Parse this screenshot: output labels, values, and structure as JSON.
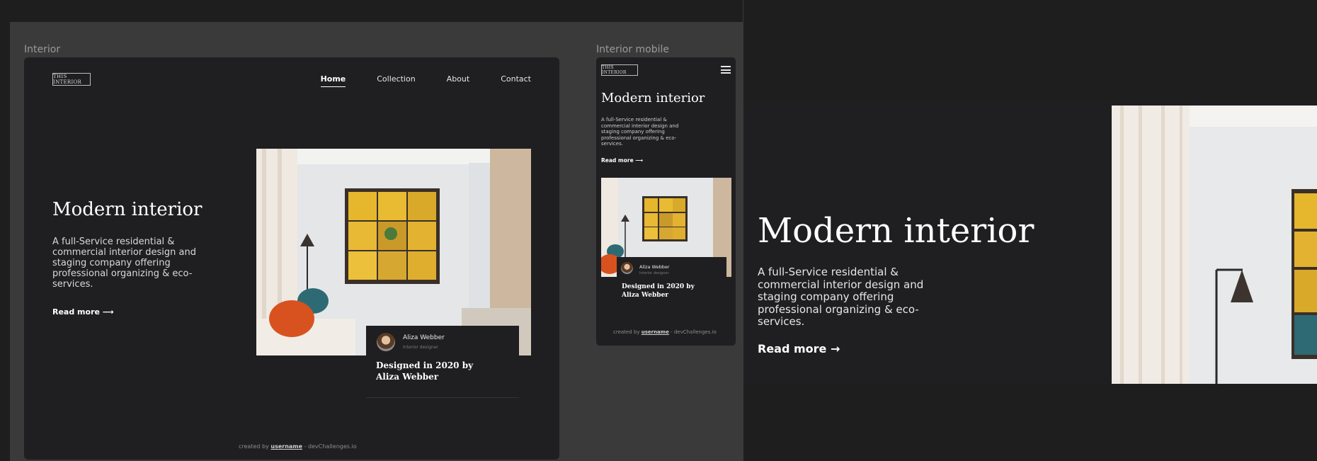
{
  "frames": {
    "desktop_label": "Interior",
    "mobile_label": "Interior mobile"
  },
  "site": {
    "logo": "THIS INTERIOR",
    "nav": [
      {
        "label": "Home",
        "active": true
      },
      {
        "label": "Collection",
        "active": false
      },
      {
        "label": "About",
        "active": false
      },
      {
        "label": "Contact",
        "active": false
      }
    ],
    "hero": {
      "title": "Modern interior",
      "text": "A full-Service residential & commercial interior design and staging company offering professional organizing & eco-services.",
      "read_more": "Read more",
      "arrow": "⟶",
      "arrow_large": "→"
    },
    "card": {
      "name": "Aliza Webber",
      "role": "Interior designer",
      "title": "Designed in 2020 by Aliza Webber"
    },
    "footer": {
      "prefix": "created by",
      "username": "username",
      "suffix": "- devChallenges.io"
    }
  },
  "icons": {
    "menu": "hamburger-menu-icon",
    "arrow": "arrow-right-icon"
  },
  "colors": {
    "background": "#1e1e1e",
    "frame": "#1f1f21",
    "canvas": "#3a3a3a",
    "accent": "#f4c430"
  }
}
